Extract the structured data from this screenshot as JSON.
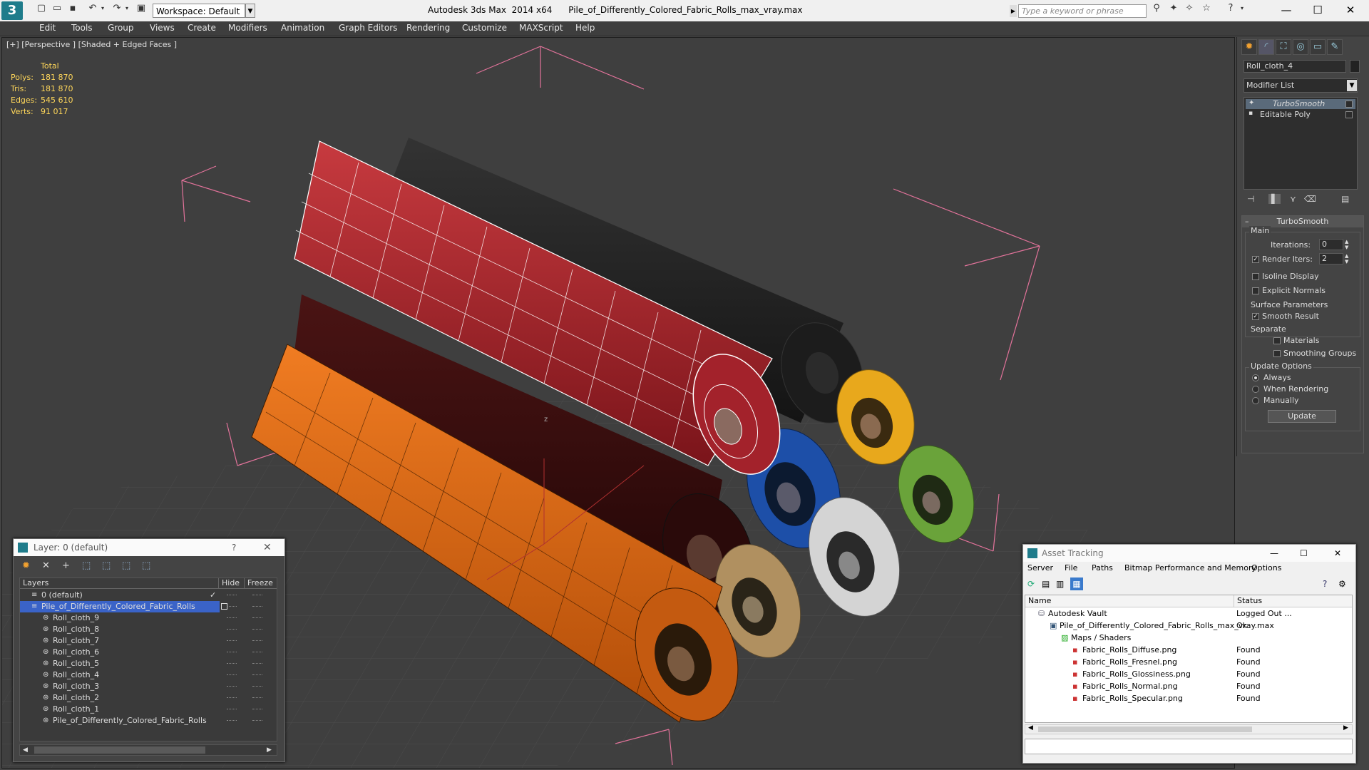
{
  "titlebar": {
    "app_title": "Autodesk 3ds Max  2014 x64",
    "file_name": "Pile_of_Differently_Colored_Fabric_Rolls_max_vray.max",
    "workspace": "Workspace: Default",
    "search_placeholder": "Type a keyword or phrase"
  },
  "menu": [
    "Edit",
    "Tools",
    "Group",
    "Views",
    "Create",
    "Modifiers",
    "Animation",
    "Graph Editors",
    "Rendering",
    "Customize",
    "MAXScript",
    "Help"
  ],
  "viewport": {
    "label": "[+] [Perspective ] [Shaded + Edged Faces ]",
    "stats": {
      "header": "Total",
      "rows": [
        {
          "label": "Polys:",
          "value": "181 870"
        },
        {
          "label": "Tris:",
          "value": "181 870"
        },
        {
          "label": "Edges:",
          "value": "545 610"
        },
        {
          "label": "Verts:",
          "value": "91 017"
        }
      ]
    },
    "axis_label": "z"
  },
  "command_panel": {
    "object_name": "Roll_cloth_4",
    "modifier_list": "Modifier List",
    "stack": [
      "TurboSmooth",
      "Editable Poly"
    ],
    "rollout_title": "TurboSmooth",
    "main_label": "Main",
    "iterations_label": "Iterations:",
    "iterations_value": "0",
    "render_iters_label": "Render Iters:",
    "render_iters_value": "2",
    "isoline_label": "Isoline Display",
    "explicit_normals_label": "Explicit Normals",
    "surface_params_label": "Surface Parameters",
    "smooth_result_label": "Smooth Result",
    "separate_label": "Separate",
    "materials_label": "Materials",
    "smoothing_groups_label": "Smoothing Groups",
    "update_options_label": "Update Options",
    "always_label": "Always",
    "when_rendering_label": "When Rendering",
    "manually_label": "Manually",
    "update_button": "Update"
  },
  "layer_dialog": {
    "title": "Layer: 0 (default)",
    "help": "?",
    "columns": {
      "layers": "Layers",
      "hide": "Hide",
      "freeze": "Freeze"
    },
    "rows": [
      {
        "name": "0 (default)",
        "level": 0
      },
      {
        "name": "Pile_of_Differently_Colored_Fabric_Rolls",
        "level": 0
      },
      {
        "name": "Roll_cloth_9",
        "level": 1
      },
      {
        "name": "Roll_cloth_8",
        "level": 1
      },
      {
        "name": "Roll_cloth_7",
        "level": 1
      },
      {
        "name": "Roll_cloth_6",
        "level": 1
      },
      {
        "name": "Roll_cloth_5",
        "level": 1
      },
      {
        "name": "Roll_cloth_4",
        "level": 1
      },
      {
        "name": "Roll_cloth_3",
        "level": 1
      },
      {
        "name": "Roll_cloth_2",
        "level": 1
      },
      {
        "name": "Roll_cloth_1",
        "level": 1
      },
      {
        "name": "Pile_of_Differently_Colored_Fabric_Rolls",
        "level": 1
      }
    ]
  },
  "asset_tracking": {
    "title": "Asset Tracking",
    "menu": [
      "Server",
      "File",
      "Paths",
      "Bitmap Performance and Memory",
      "Options"
    ],
    "columns": {
      "name": "Name",
      "status": "Status"
    },
    "rows": [
      {
        "name": "Autodesk Vault",
        "status": "Logged Out ...",
        "level": 0,
        "icon": "vault-icon"
      },
      {
        "name": "Pile_of_Differently_Colored_Fabric_Rolls_max_vray.max",
        "status": "Ok",
        "level": 1,
        "icon": "max-file-icon"
      },
      {
        "name": "Maps / Shaders",
        "status": "",
        "level": 2,
        "icon": "maps-icon"
      },
      {
        "name": "Fabric_Rolls_Diffuse.png",
        "status": "Found",
        "level": 3,
        "icon": "png-icon"
      },
      {
        "name": "Fabric_Rolls_Fresnel.png",
        "status": "Found",
        "level": 3,
        "icon": "png-icon"
      },
      {
        "name": "Fabric_Rolls_Glossiness.png",
        "status": "Found",
        "level": 3,
        "icon": "png-icon"
      },
      {
        "name": "Fabric_Rolls_Normal.png",
        "status": "Found",
        "level": 3,
        "icon": "png-icon"
      },
      {
        "name": "Fabric_Rolls_Specular.png",
        "status": "Found",
        "level": 3,
        "icon": "png-icon"
      }
    ]
  },
  "colors": {
    "accent": "#1f7c8b",
    "selection": "#3a63c8",
    "stats_yellow": "#ffd75a",
    "bbox_pink": "#e3739b",
    "roll_red": "#a3222b",
    "roll_orange": "#e06a10",
    "roll_black": "#222222",
    "roll_darkred": "#3a0c0c",
    "roll_yellow": "#e8a81c",
    "roll_blue": "#1d4fa8",
    "roll_green": "#6aa33a",
    "roll_white": "#d4d4d4",
    "roll_beige": "#b09060"
  }
}
